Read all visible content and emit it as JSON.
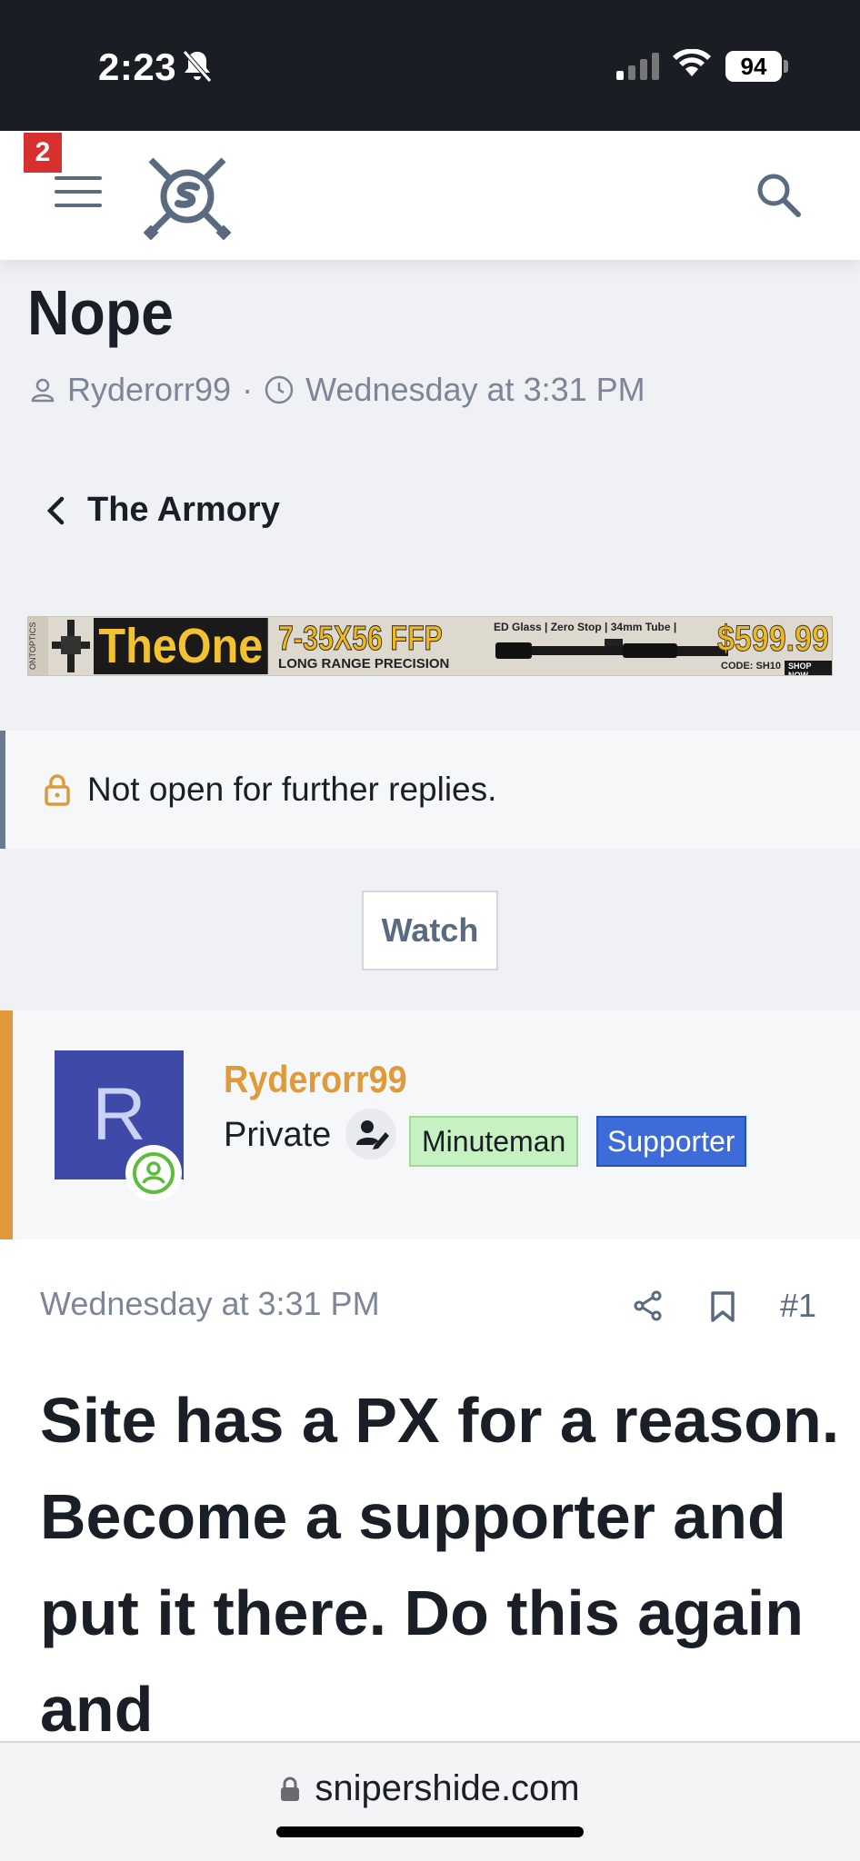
{
  "status_bar": {
    "time": "2:23",
    "battery": "94"
  },
  "navbar": {
    "notification_count": "2"
  },
  "thread": {
    "title": "Nope",
    "author": "Ryderorr99",
    "separator": "·",
    "date": "Wednesday at 3:31 PM",
    "back_label": "The Armory",
    "notice": "Not open for further replies.",
    "watch_label": "Watch"
  },
  "banner": {
    "brand": "ONTOPTICS",
    "product": "TheOne",
    "spec": "7-35X56 FFP",
    "subtitle": "LONG RANGE PRECISION",
    "features": "ED Glass | Zero Stop | 34mm Tube |",
    "price": "$599.99",
    "code": "CODE: SH10",
    "cta": "SHOP NOW"
  },
  "author_card": {
    "avatar_letter": "R",
    "username": "Ryderorr99",
    "rank": "Private",
    "tags": [
      "Minuteman",
      "Supporter"
    ]
  },
  "post": {
    "date": "Wednesday at 3:31 PM",
    "number": "#1",
    "body": "Site has a PX for a reason. Become a supporter and put it there. Do this again and"
  },
  "browser": {
    "url": "snipershide.com"
  },
  "colors": {
    "accent_orange": "#e09a3c",
    "notice_badge": "#d82f2f",
    "avatar_bg": "#3f4aa8",
    "supporter_tag": "#3d6bd8",
    "minuteman_tag": "#c6f2c2",
    "online_green": "#5bbd3a"
  }
}
